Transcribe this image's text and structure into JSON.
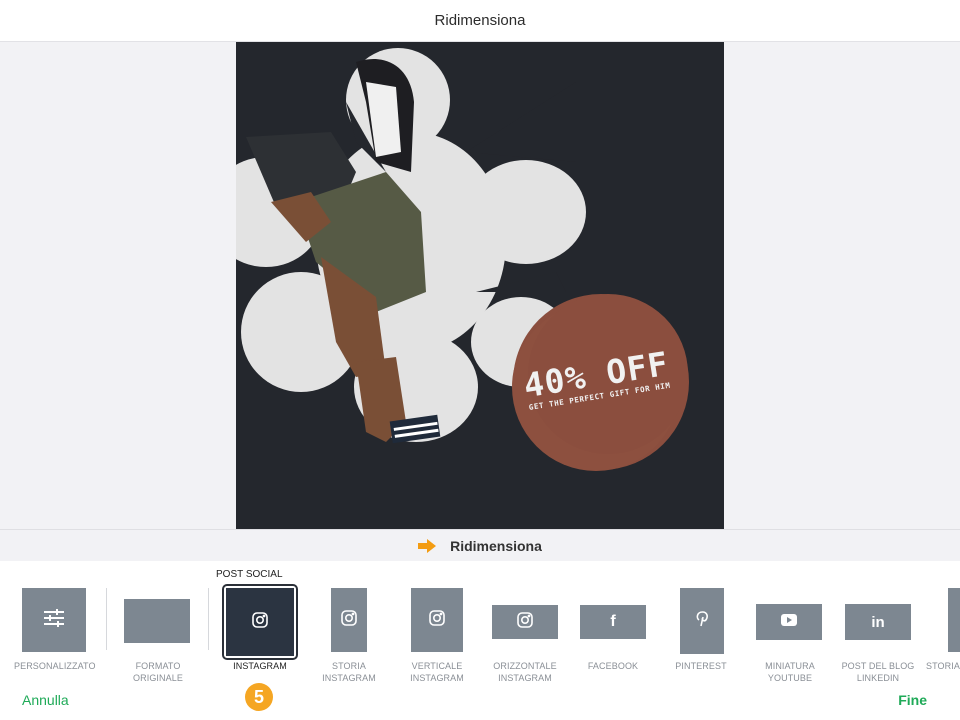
{
  "header": {
    "title": "Ridimensiona"
  },
  "hint": {
    "label": "Ridimensiona"
  },
  "artboard": {
    "offer_headline": "40% OFF",
    "offer_subline": "GET THE PERFECT GIFT FOR HIM",
    "colors": {
      "background": "#24272d",
      "shape": "#e3e3e3",
      "badge": "#8b4e3e"
    }
  },
  "tray": {
    "group_label": "POST SOCIAL",
    "presets": [
      {
        "label": "PERSONALIZZATO",
        "icon": "sliders-icon"
      },
      {
        "label": "FORMATO ORIGINALE",
        "icon": ""
      },
      {
        "label": "INSTAGRAM",
        "icon": "instagram-icon",
        "selected": true
      },
      {
        "label": "STORIA INSTAGRAM",
        "icon": "instagram-icon"
      },
      {
        "label": "VERTICALE INSTAGRAM",
        "icon": "instagram-icon"
      },
      {
        "label": "ORIZZONTALE INSTAGRAM",
        "icon": "instagram-icon"
      },
      {
        "label": "FACEBOOK",
        "icon": "facebook-icon"
      },
      {
        "label": "PINTEREST",
        "icon": "pinterest-icon"
      },
      {
        "label": "MINIATURA YOUTUBE",
        "icon": "youtube-icon"
      },
      {
        "label": "POST DEL BLOG LINKEDIN",
        "icon": "linkedin-icon"
      },
      {
        "label": "STORIA",
        "icon": ""
      }
    ]
  },
  "footer": {
    "cancel_label": "Annulla",
    "done_label": "Fine",
    "step_number": "5"
  },
  "colors": {
    "accent": "#1faa58",
    "arrow": "#f39c12",
    "thumb": "#7d8791",
    "selected_thumb": "#2b3441"
  }
}
